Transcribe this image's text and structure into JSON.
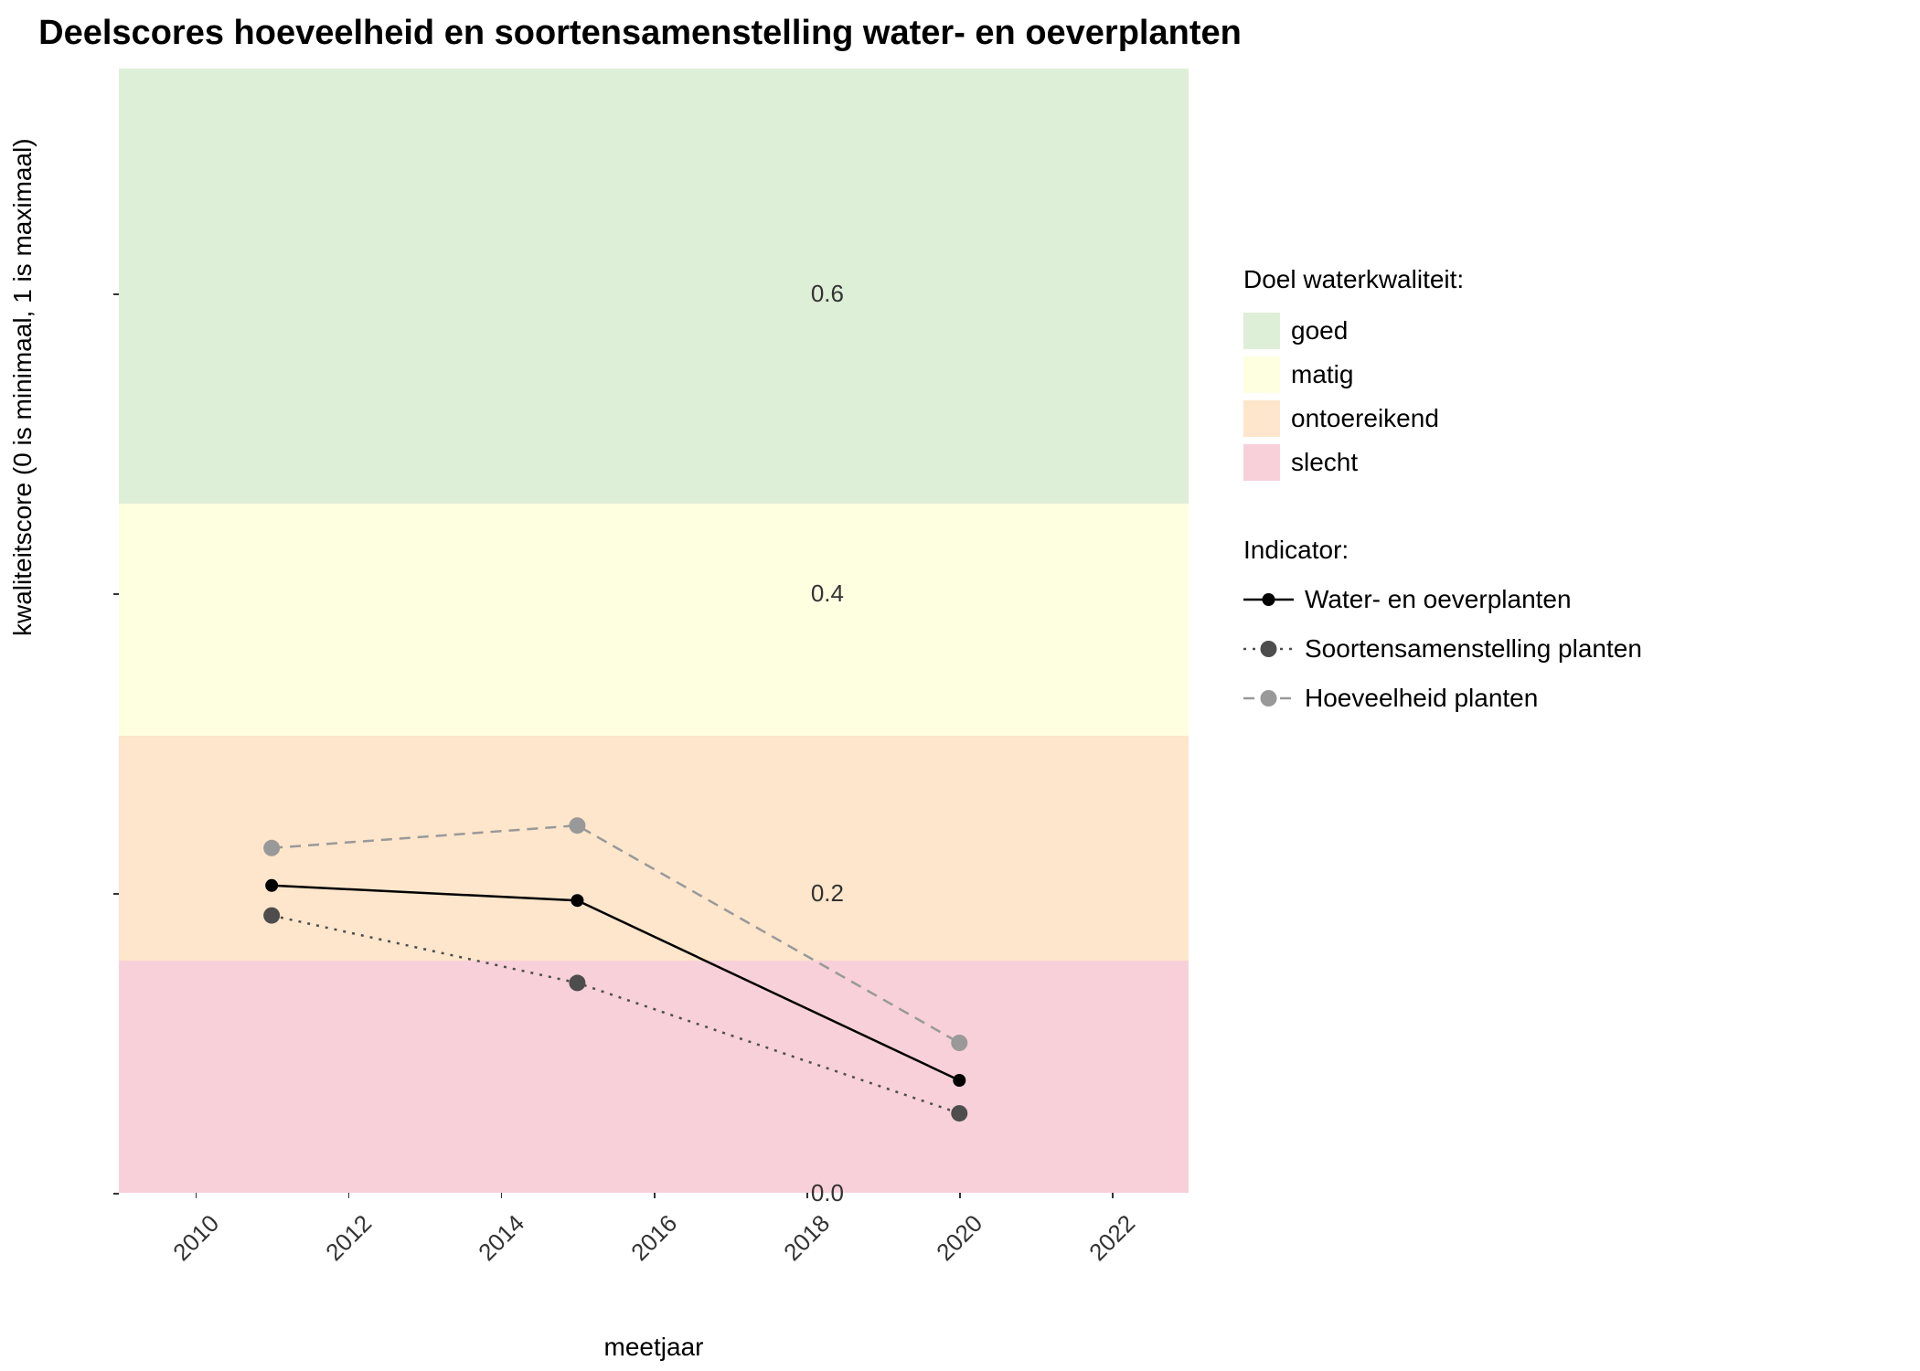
{
  "chart_data": {
    "type": "line",
    "title": "Deelscores hoeveelheid en soortensamenstelling water- en oeverplanten",
    "xlabel": "meetjaar",
    "ylabel": "kwaliteitscore (0 is minimaal, 1 is maximaal)",
    "x": [
      2011,
      2015,
      2020
    ],
    "xlim": [
      2009,
      2023
    ],
    "ylim": [
      0.0,
      0.75
    ],
    "x_ticks": [
      2010,
      2012,
      2014,
      2016,
      2018,
      2020,
      2022
    ],
    "y_ticks": [
      0.0,
      0.2,
      0.4,
      0.6
    ],
    "series": [
      {
        "name": "Water- en oeverplanten",
        "values": [
          0.205,
          0.195,
          0.075
        ],
        "line": "solid",
        "color": "#000000"
      },
      {
        "name": "Soortensamenstelling planten",
        "values": [
          0.185,
          0.14,
          0.053
        ],
        "line": "dotted",
        "color": "#4d4d4d"
      },
      {
        "name": "Hoeveelheid planten",
        "values": [
          0.23,
          0.245,
          0.1
        ],
        "line": "dashed",
        "color": "#999999"
      }
    ],
    "bands": [
      {
        "name": "goed",
        "ymin": 0.46,
        "ymax": 0.75,
        "color": "#deefd7"
      },
      {
        "name": "matig",
        "ymin": 0.305,
        "ymax": 0.46,
        "color": "#fefee1"
      },
      {
        "name": "ontoereikend",
        "ymin": 0.155,
        "ymax": 0.305,
        "color": "#fde6cb"
      },
      {
        "name": "slecht",
        "ymin": 0.0,
        "ymax": 0.155,
        "color": "#f8d0d9"
      }
    ],
    "legend_band_title": "Doel waterkwaliteit:",
    "legend_indicator_title": "Indicator:"
  }
}
